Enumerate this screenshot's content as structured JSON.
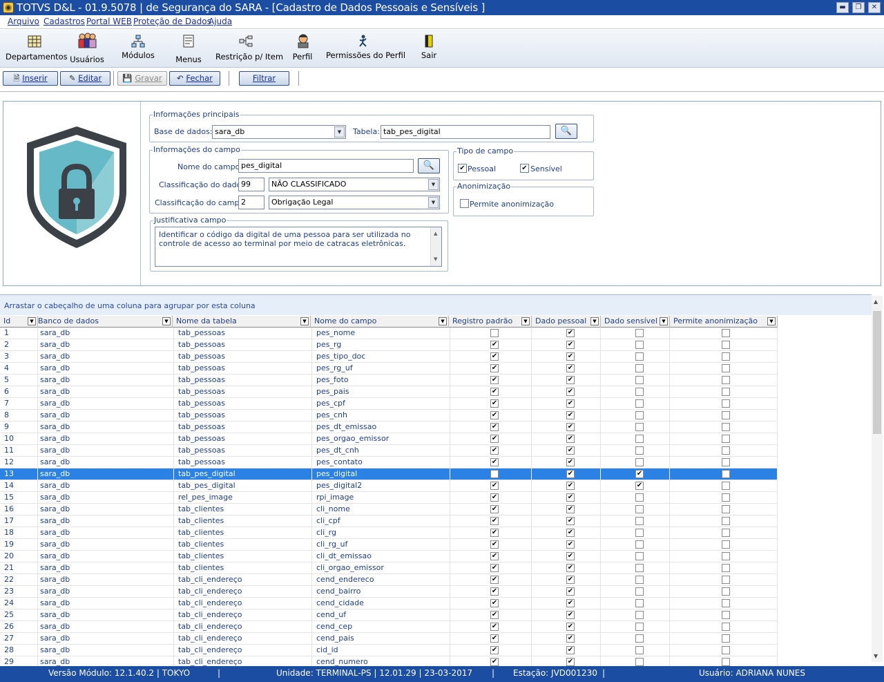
{
  "window": {
    "title": "TOTVS D&L - 01.9.5078 | de Segurança do SARA - [Cadastro de Dados Pessoais e Sensíveis ]"
  },
  "menu": [
    "Arquivo",
    "Cadastros",
    "Portal WEB",
    "Proteção de Dados",
    "Ajuda"
  ],
  "ribbon": {
    "departamentos": "Departamentos",
    "usuarios": "Usuários",
    "modulos": "Módulos",
    "menus": "Menus",
    "restricao": "Restrição p/ Item",
    "perfil": "Perfil",
    "permissoes": "Permissões do Perfil",
    "sair": "Sair"
  },
  "toolbar": {
    "inserir": "Inserir",
    "editar": "Editar",
    "gravar": "Gravar",
    "fechar": "Fechar",
    "filtrar": "Filtrar"
  },
  "form": {
    "info_principais": "Informações principais",
    "base_label": "Base de dados:",
    "base_value": "sara_db",
    "tabela_label": "Tabela:",
    "tabela_value": "tab_pes_digital",
    "info_campo": "Informações do campo",
    "nome_label": "Nome do campo:",
    "nome_value": "pes_digital",
    "class_dado_label": "Classificação do dado:",
    "class_dado_code": "99",
    "class_dado_value": "NÃO CLASSIFICADO",
    "class_campo_label": "Classificação do campo:",
    "class_campo_code": "2",
    "class_campo_value": "Obrigação Legal",
    "tipo_campo": "Tipo de campo",
    "pessoal": "Pessoal",
    "pessoal_checked": true,
    "sensivel": "Sensível",
    "sensivel_checked": true,
    "anonimizacao": "Anonimização",
    "permite_anon": "Permite anonimização",
    "permite_anon_checked": false,
    "justificativa": "Justificativa campo",
    "justificativa_text": "Identificar o código da digital de uma pessoa para ser utilizada no controle de acesso ao terminal por meio de catracas eletrônicas."
  },
  "grid": {
    "group_hint": "Arrastar o cabeçalho de uma coluna para agrupar por esta coluna",
    "columns": [
      "Id",
      "Banco de dados",
      "Nome da tabela",
      "Nome do campo",
      "Registro padrão",
      "Dado pessoal",
      "Dado sensível",
      "Permite anonimização"
    ],
    "selected_id": 13,
    "rows": [
      [
        "1",
        "sara_db",
        "tab_pessoas",
        "pes_nome",
        0,
        1,
        0,
        0
      ],
      [
        "2",
        "sara_db",
        "tab_pessoas",
        "pes_rg",
        1,
        1,
        0,
        0
      ],
      [
        "3",
        "sara_db",
        "tab_pessoas",
        "pes_tipo_doc",
        1,
        1,
        0,
        0
      ],
      [
        "4",
        "sara_db",
        "tab_pessoas",
        "pes_rg_uf",
        1,
        1,
        0,
        0
      ],
      [
        "5",
        "sara_db",
        "tab_pessoas",
        "pes_foto",
        1,
        1,
        0,
        0
      ],
      [
        "6",
        "sara_db",
        "tab_pessoas",
        "pes_pais",
        1,
        1,
        0,
        0
      ],
      [
        "7",
        "sara_db",
        "tab_pessoas",
        "pes_cpf",
        1,
        1,
        0,
        0
      ],
      [
        "8",
        "sara_db",
        "tab_pessoas",
        "pes_cnh",
        1,
        1,
        0,
        0
      ],
      [
        "9",
        "sara_db",
        "tab_pessoas",
        "pes_dt_emissao",
        1,
        1,
        0,
        0
      ],
      [
        "10",
        "sara_db",
        "tab_pessoas",
        "pes_orgao_emissor",
        1,
        1,
        0,
        0
      ],
      [
        "11",
        "sara_db",
        "tab_pessoas",
        "pes_dt_cnh",
        1,
        1,
        0,
        0
      ],
      [
        "12",
        "sara_db",
        "tab_pessoas",
        "pes_contato",
        1,
        1,
        0,
        0
      ],
      [
        "13",
        "sara_db",
        "tab_pes_digital",
        "pes_digital",
        0,
        1,
        1,
        0
      ],
      [
        "14",
        "sara_db",
        "tab_pes_digital",
        "pes_digital2",
        1,
        1,
        1,
        0
      ],
      [
        "15",
        "sara_db",
        "rel_pes_image",
        "rpi_image",
        1,
        1,
        0,
        0
      ],
      [
        "16",
        "sara_db",
        "tab_clientes",
        "cli_nome",
        1,
        1,
        0,
        0
      ],
      [
        "17",
        "sara_db",
        "tab_clientes",
        "cli_cpf",
        1,
        1,
        0,
        0
      ],
      [
        "18",
        "sara_db",
        "tab_clientes",
        "cli_rg",
        1,
        1,
        0,
        0
      ],
      [
        "19",
        "sara_db",
        "tab_clientes",
        "cli_rg_uf",
        1,
        1,
        0,
        0
      ],
      [
        "20",
        "sara_db",
        "tab_clientes",
        "cli_dt_emissao",
        1,
        1,
        0,
        0
      ],
      [
        "21",
        "sara_db",
        "tab_clientes",
        "cli_orgao_emissor",
        1,
        1,
        0,
        0
      ],
      [
        "22",
        "sara_db",
        "tab_cli_endereço",
        "cend_endereco",
        1,
        1,
        0,
        0
      ],
      [
        "23",
        "sara_db",
        "tab_cli_endereço",
        "cend_bairro",
        1,
        1,
        0,
        0
      ],
      [
        "24",
        "sara_db",
        "tab_cli_endereço",
        "cend_cidade",
        1,
        1,
        0,
        0
      ],
      [
        "25",
        "sara_db",
        "tab_cli_endereço",
        "cend_uf",
        1,
        1,
        0,
        0
      ],
      [
        "26",
        "sara_db",
        "tab_cli_endereço",
        "cend_cep",
        1,
        1,
        0,
        0
      ],
      [
        "27",
        "sara_db",
        "tab_cli_endereço",
        "cend_pais",
        1,
        1,
        0,
        0
      ],
      [
        "28",
        "sara_db",
        "tab_cli_endereço",
        "cid_id",
        1,
        1,
        0,
        0
      ],
      [
        "29",
        "sara_db",
        "tab_cli_endereço",
        "cend_numero",
        1,
        1,
        0,
        0
      ]
    ]
  },
  "status": {
    "versao": "Versão Módulo:  12.1.40.2  |  TOKYO",
    "unidade": "Unidade:  TERMINAL-PS | 12.01.29 | 23-03-2017",
    "estacao": "Estação: JVD001230",
    "usuario": "Usuário: ADRIANA NUNES"
  },
  "colors": {
    "title_bar": "#1b4da2",
    "selected_row": "#2b81e4",
    "label_text": "#1f3f86",
    "shield_fill": "#66b9c6"
  }
}
